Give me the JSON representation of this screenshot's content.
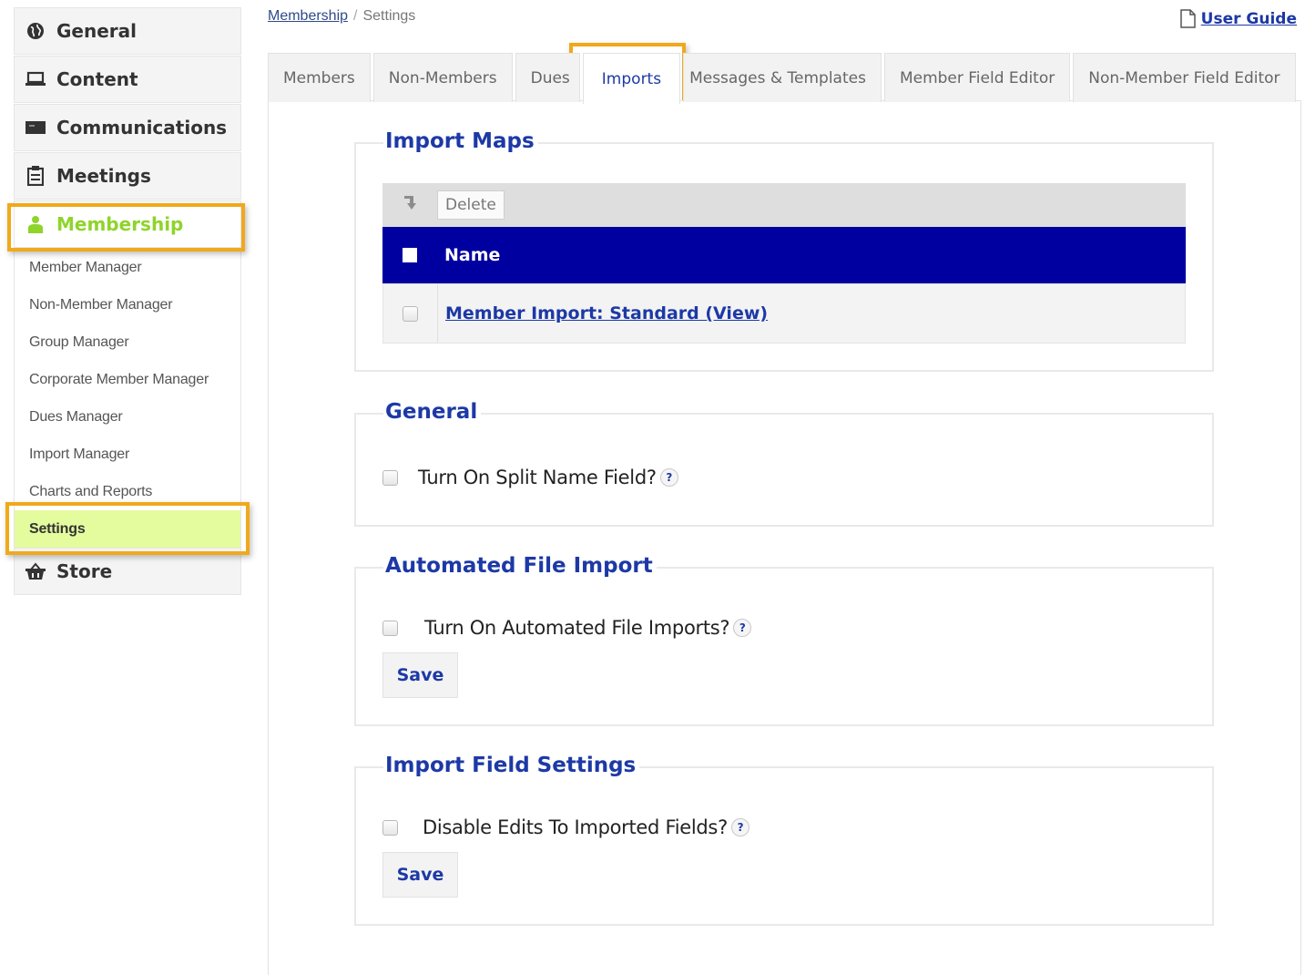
{
  "sidebar": {
    "main_items": [
      {
        "label": "General",
        "icon": "globe-icon"
      },
      {
        "label": "Content",
        "icon": "laptop-icon"
      },
      {
        "label": "Communications",
        "icon": "envelope-icon"
      },
      {
        "label": "Meetings",
        "icon": "clipboard-icon"
      },
      {
        "label": "Membership",
        "icon": "user-icon"
      }
    ],
    "sub_items": [
      "Member Manager",
      "Non-Member Manager",
      "Group Manager",
      "Corporate Member Manager",
      "Dues Manager",
      "Import Manager",
      "Charts and Reports",
      "Settings"
    ],
    "store": {
      "label": "Store",
      "icon": "basket-icon"
    }
  },
  "breadcrumb": {
    "parent": "Membership",
    "separator": "/",
    "current": "Settings"
  },
  "user_guide": {
    "label": "User Guide",
    "icon": "document-icon"
  },
  "tabs": [
    "Members",
    "Non-Members",
    "Dues",
    "Imports",
    "Messages & Templates",
    "Member Field Editor",
    "Non-Member Field Editor"
  ],
  "active_tab": "Imports",
  "import_maps": {
    "legend": "Import Maps",
    "delete_label": "Delete",
    "column_name": "Name",
    "rows": [
      "Member Import: Standard (View)"
    ]
  },
  "general": {
    "legend": "General",
    "split_name_label": "Turn On Split Name Field?",
    "help": "?"
  },
  "automated": {
    "legend": "Automated File Import",
    "label": "Turn On Automated File Imports?",
    "help": "?",
    "save_label": "Save"
  },
  "field_settings": {
    "legend": "Import Field Settings",
    "label": "Disable Edits To Imported Fields?",
    "help": "?",
    "save_label": "Save"
  },
  "colors": {
    "accent_blue": "#1d39a6",
    "header_blue": "#0000a0",
    "membership_green": "#8fd42a",
    "settings_highlight": "#e4fb9e",
    "annotation_orange": "#f0a91b"
  }
}
